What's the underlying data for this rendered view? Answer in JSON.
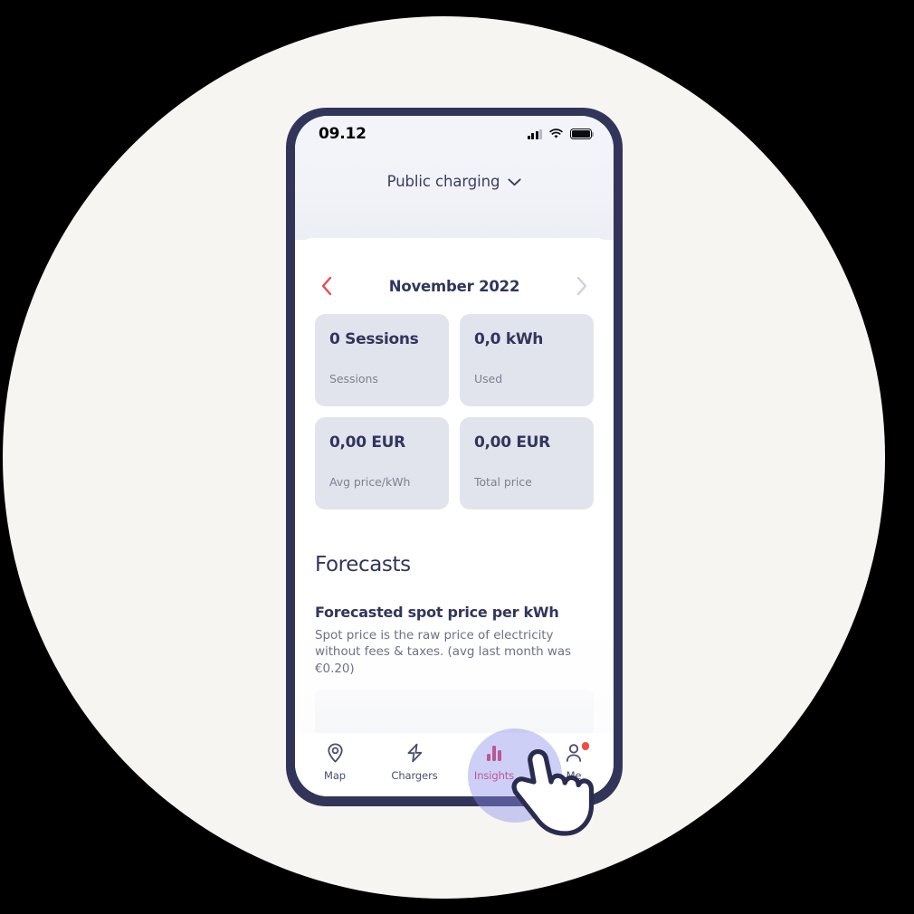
{
  "statusbar": {
    "time": "09.12",
    "signal_icon": "signal-bars-icon",
    "wifi_icon": "wifi-icon",
    "battery_icon": "battery-full-icon"
  },
  "header": {
    "segment_label": "Public charging",
    "chevron_icon": "chevron-down-icon"
  },
  "month_nav": {
    "prev_icon": "chevron-left-icon",
    "next_icon": "chevron-right-icon",
    "title": "November 2022",
    "prev_color": "#ea4a50",
    "next_color": "#cfd1db"
  },
  "stats": [
    {
      "value": "0 Sessions",
      "label": "Sessions"
    },
    {
      "value": "0,0 kWh",
      "label": "Used"
    },
    {
      "value": "0,00 EUR",
      "label": "Avg price/kWh"
    },
    {
      "value": "0,00 EUR",
      "label": "Total price"
    }
  ],
  "forecasts": {
    "section_title": "Forecasts",
    "card_title": "Forecasted spot price per kWh",
    "card_body": "Spot price is the raw price of electricity without fees & taxes. (avg last month was €0.20)"
  },
  "tabbar": {
    "items": [
      {
        "label": "Map",
        "icon": "map-pin-icon",
        "active": false,
        "badge": false
      },
      {
        "label": "Chargers",
        "icon": "lightning-bolt-icon",
        "active": false,
        "badge": false
      },
      {
        "label": "Insights",
        "icon": "bar-chart-icon",
        "active": true,
        "badge": false
      },
      {
        "label": "Me",
        "icon": "person-icon",
        "active": false,
        "badge": true
      }
    ]
  },
  "cursor": {
    "icon": "pointing-hand-cursor",
    "tap_highlight_color": "#8b8deb"
  },
  "colors": {
    "page_background": "#000000",
    "circle_background": "#f7f5f2",
    "phone_bezel": "#323459",
    "card_background": "#e2e4ed",
    "text_primary": "#32355c",
    "text_muted": "#7d8094",
    "accent_red": "#e0324f"
  }
}
